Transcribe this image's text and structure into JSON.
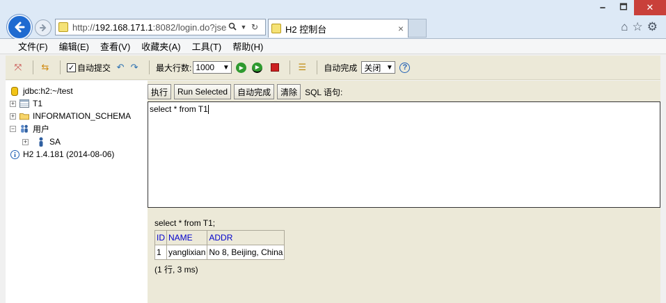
{
  "browser": {
    "address_prefix": "http://",
    "address_host": "192.168.171.1",
    "address_rest": ":8082/login.do?jses",
    "tab_title": "H2 控制台",
    "window_buttons": [
      "🗕",
      "🗖",
      "✕"
    ]
  },
  "menubar": [
    "文件(F)",
    "编辑(E)",
    "查看(V)",
    "收藏夹(A)",
    "工具(T)",
    "帮助(H)"
  ],
  "toolbar": {
    "autocommit_label": "自动提交",
    "autocommit_checked": true,
    "max_rows_label": "最大行数:",
    "max_rows_value": "1000",
    "autocomplete_label": "自动完成",
    "autocomplete_value": "关闭"
  },
  "tree": {
    "connection": "jdbc:h2:~/test",
    "items": [
      {
        "label": "T1",
        "icon": "table-icon",
        "expand": "+"
      },
      {
        "label": "INFORMATION_SCHEMA",
        "icon": "folder-icon",
        "expand": "+"
      },
      {
        "label": "用户",
        "icon": "users-icon",
        "expand": "−"
      },
      {
        "label": "SA",
        "icon": "user-icon",
        "expand": "+"
      }
    ],
    "version": "H2 1.4.181 (2014-08-06)"
  },
  "buttons": {
    "execute": "执行",
    "run_selected": "Run Selected",
    "autocomplete": "自动完成",
    "clear": "清除",
    "sql_label": "SQL 语句:"
  },
  "editor": {
    "sql": "select * from T1"
  },
  "result": {
    "query": "select * from T1;",
    "columns": [
      "ID",
      "NAME",
      "ADDR"
    ],
    "rows": [
      [
        "1",
        "yanglixian",
        "No 8, Beijing, China"
      ]
    ],
    "status": "(1 行, 3 ms)"
  }
}
